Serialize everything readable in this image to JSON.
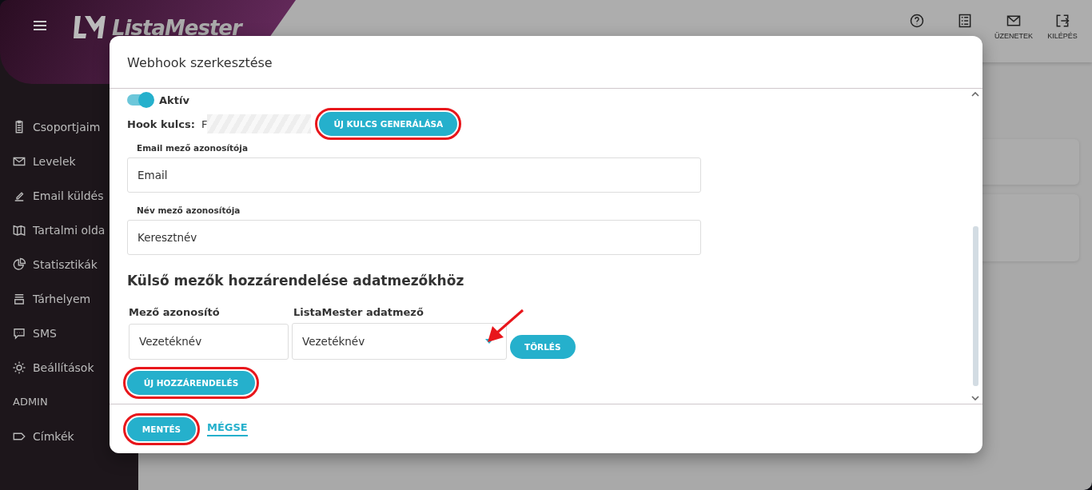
{
  "app": {
    "logo": "ListaMester"
  },
  "top_bar": {
    "actions": [
      {
        "label": "ÜZENETEK"
      },
      {
        "label": "KILÉPÉS"
      }
    ]
  },
  "sidebar": {
    "items": [
      {
        "kind": "item",
        "label": "Csoportjaim"
      },
      {
        "kind": "item",
        "label": "Levelek"
      },
      {
        "kind": "item",
        "label": "Email küldés"
      },
      {
        "kind": "item",
        "label": "Tartalmi olda"
      },
      {
        "kind": "item",
        "label": "Statisztikák"
      },
      {
        "kind": "item",
        "label": "Tárhelyem"
      },
      {
        "kind": "item",
        "label": "SMS"
      },
      {
        "kind": "item",
        "label": "Beállítások"
      },
      {
        "kind": "section",
        "label": "ADMIN"
      },
      {
        "kind": "item",
        "label": "Címkék"
      }
    ]
  },
  "modal": {
    "title": "Webhook szerkesztése",
    "active_toggle": {
      "label": "Aktív",
      "on": true
    },
    "hook_key": {
      "label": "Hook kulcs:",
      "value": "F",
      "button": {
        "label": "ÚJ KULCS GENERÁLÁSA",
        "highlighted": true
      }
    },
    "fields": [
      {
        "label": "Email mező azonosítója",
        "value": "Email"
      },
      {
        "label": "Név mező azonosítója",
        "value": "Keresztnév"
      }
    ],
    "mapping": {
      "heading": "Külső mezők hozzárendelése adatmezőkhöz",
      "columns": [
        "Mező azonosító",
        "ListaMester adatmező"
      ],
      "rows": [
        {
          "field": "Vezetéknév",
          "data_field": "Vezetéknév",
          "delete": "TÖRLÉS"
        }
      ],
      "add_button": {
        "label": "ÚJ HOZZÁRENDELÉS",
        "highlighted": true
      }
    },
    "footer": {
      "save": {
        "label": "MENTÉS",
        "highlighted": true
      },
      "cancel": "MÉGSE"
    }
  }
}
